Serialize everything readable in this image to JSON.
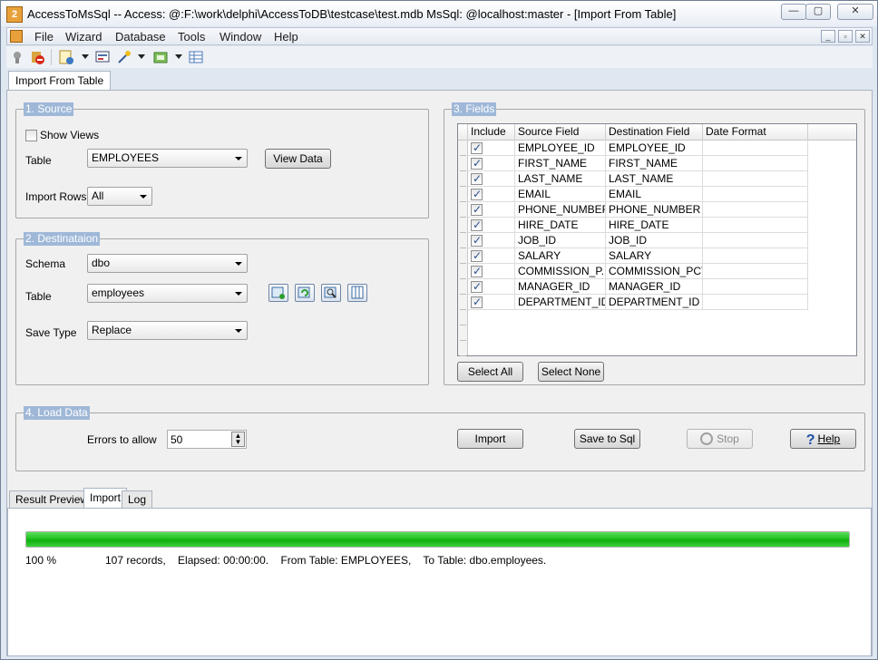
{
  "window": {
    "title": "AccessToMsSql -- Access: @:F:\\work\\delphi\\AccessToDB\\testcase\\test.mdb MsSql: @localhost:master - [Import From Table]",
    "app_icon_text": "2",
    "minimize": "—",
    "maximize": "▢",
    "close": "✕"
  },
  "menu": {
    "items": [
      "File",
      "Wizard",
      "Database",
      "Tools",
      "Window",
      "Help"
    ],
    "mdi_min": "_",
    "mdi_restore": "▫",
    "mdi_close": "✕"
  },
  "toolbar": {
    "icons": [
      "connect-icon",
      "disconnect-icon",
      "wizard-icon",
      "report-icon",
      "magic-wand-icon",
      "window-icon",
      "table-icon"
    ]
  },
  "doc_tab": "Import From Table",
  "source": {
    "title": "1. Source",
    "show_views_label": "Show Views",
    "show_views_checked": false,
    "table_label": "Table",
    "table_value": "EMPLOYEES",
    "view_data_button": "View Data",
    "import_rows_label": "Import Rows",
    "import_rows_value": "All"
  },
  "destination": {
    "title": "2. Destinataion",
    "schema_label": "Schema",
    "schema_value": "dbo",
    "table_label": "Table",
    "table_value": "employees",
    "save_type_label": "Save Type",
    "save_type_value": "Replace",
    "icon_buttons": [
      "new-table-icon",
      "refresh-table-icon",
      "find-table-icon",
      "columns-icon"
    ]
  },
  "fields": {
    "title": "3. Fields",
    "columns": [
      "Include",
      "Source Field",
      "Destination Field",
      "Date Format"
    ],
    "rows": [
      {
        "include": true,
        "source": "EMPLOYEE_ID",
        "dest": "EMPLOYEE_ID",
        "date_format": ""
      },
      {
        "include": true,
        "source": "FIRST_NAME",
        "dest": "FIRST_NAME",
        "date_format": ""
      },
      {
        "include": true,
        "source": "LAST_NAME",
        "dest": "LAST_NAME",
        "date_format": ""
      },
      {
        "include": true,
        "source": "EMAIL",
        "dest": "EMAIL",
        "date_format": ""
      },
      {
        "include": true,
        "source": "PHONE_NUMBER",
        "dest": "PHONE_NUMBER",
        "date_format": ""
      },
      {
        "include": true,
        "source": "HIRE_DATE",
        "dest": "HIRE_DATE",
        "date_format": ""
      },
      {
        "include": true,
        "source": "JOB_ID",
        "dest": "JOB_ID",
        "date_format": ""
      },
      {
        "include": true,
        "source": "SALARY",
        "dest": "SALARY",
        "date_format": ""
      },
      {
        "include": true,
        "source": "COMMISSION_P...",
        "dest": "COMMISSION_PCT",
        "date_format": ""
      },
      {
        "include": true,
        "source": "MANAGER_ID",
        "dest": "MANAGER_ID",
        "date_format": ""
      },
      {
        "include": true,
        "source": "DEPARTMENT_ID",
        "dest": "DEPARTMENT_ID",
        "date_format": ""
      }
    ],
    "select_all_button": "Select All",
    "select_none_button": "Select None"
  },
  "load_data": {
    "title": "4. Load Data",
    "errors_label": "Errors to allow",
    "errors_value": "50",
    "import_button": "Import",
    "save_sql_button": "Save to Sql",
    "stop_button": "Stop",
    "help_button": "Help"
  },
  "bottom_tabs": [
    "Result Preview",
    "Import",
    "Log"
  ],
  "active_bottom_tab": "Import",
  "status": {
    "progress_percent": 100,
    "percent_text": "100 %",
    "summary": "107 records,    Elapsed: 00:00:00.    From Table: EMPLOYEES,    To Table: dbo.employees."
  },
  "colors": {
    "group_title_bg": "#9fb8d8",
    "progress_green": "#1fc11f"
  }
}
